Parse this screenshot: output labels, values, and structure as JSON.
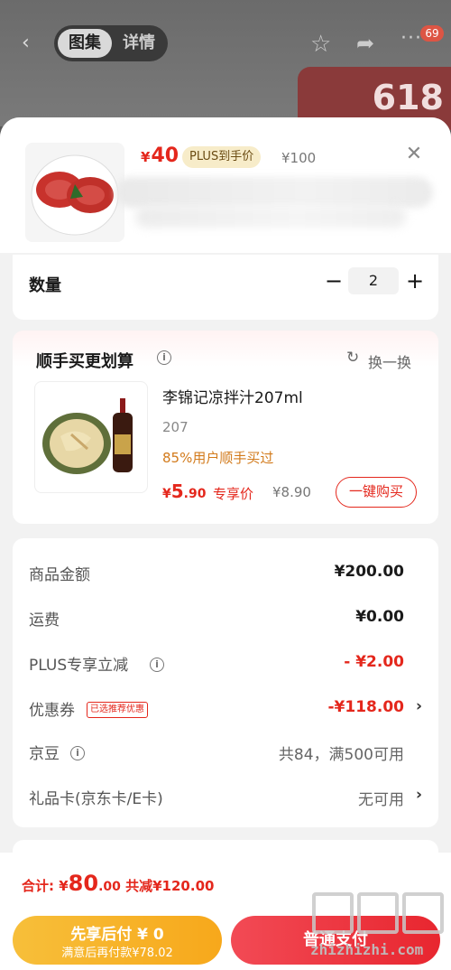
{
  "background": {
    "tabs": [
      "图集",
      "详情"
    ],
    "cart_badge": "69",
    "promo_text": "618"
  },
  "product": {
    "price_currency": "¥",
    "price": "40",
    "plus_tag": "PLUS到手价",
    "original_price": "¥100"
  },
  "quantity": {
    "label": "数量",
    "minus": "−",
    "value": "2",
    "plus": "+"
  },
  "addon": {
    "title": "顺手买更划算",
    "swap_label": "换一换",
    "name": "李锦记凉拌汁207ml",
    "spec": "207",
    "bought_text": "85%用户顺手买过",
    "price_currency": "¥",
    "price_int": "5",
    "price_dec": ".90",
    "price_tag": "专享价",
    "original_price": "¥8.90",
    "buy_button": "一键购买"
  },
  "summary": {
    "rows": [
      {
        "label": "商品金额",
        "value": "¥200.00"
      },
      {
        "label": "运费",
        "value": "¥0.00"
      },
      {
        "label": "PLUS专享立减",
        "value": "- ¥2.00"
      },
      {
        "label": "优惠券",
        "tag": "已选推荐优惠",
        "value": "-¥118.00"
      },
      {
        "label": "京豆",
        "value": "共84，满500可用"
      },
      {
        "label": "礼品卡(京东卡/E卡)",
        "value": "无可用"
      }
    ]
  },
  "bottom": {
    "total_prefix": "合计: ¥",
    "total_int": "80",
    "total_dec": ".00",
    "total_saved": "共减¥120.00",
    "later_line1": "先享后付 ¥ 0",
    "later_line2": "满意后再付款¥78.02",
    "pay_button": "普通支付"
  },
  "watermark": {
    "text": "zhizhizhi.com"
  },
  "colors": {
    "accent_red": "#e4271c",
    "plus_gold": "#f7ecc9",
    "pay_later_yellow": "#f7bf3a"
  }
}
